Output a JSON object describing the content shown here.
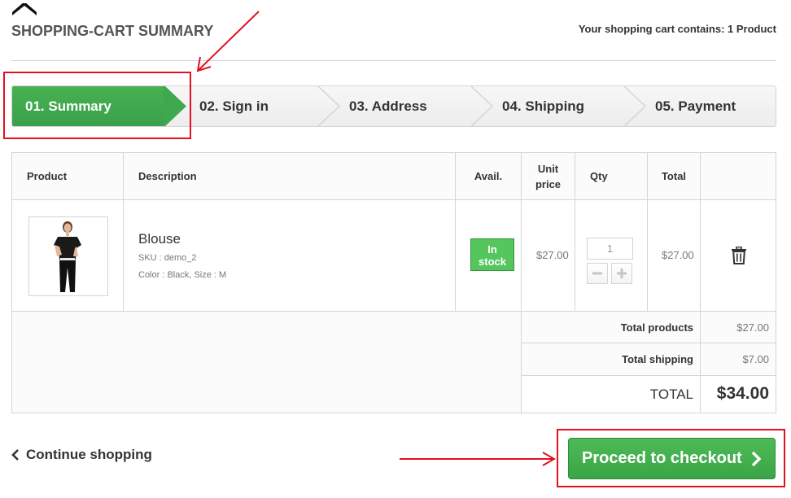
{
  "header": {
    "title": "SHOPPING-CART SUMMARY",
    "cart_count": "Your shopping cart contains: 1 Product"
  },
  "steps": [
    {
      "label": "01. Summary",
      "active": true
    },
    {
      "label": "02. Sign in",
      "active": false
    },
    {
      "label": "03. Address",
      "active": false
    },
    {
      "label": "04. Shipping",
      "active": false
    },
    {
      "label": "05. Payment",
      "active": false
    }
  ],
  "table": {
    "headers": {
      "product": "Product",
      "description": "Description",
      "avail": "Avail.",
      "unit_price_line1": "Unit",
      "unit_price_line2": "price",
      "qty": "Qty",
      "total": "Total"
    },
    "row": {
      "name": "Blouse",
      "sku": "SKU : demo_2",
      "attributes": "Color : Black, Size : M",
      "stock_line1": "In",
      "stock_line2": "stock",
      "unit_price": "$27.00",
      "qty": "1",
      "total": "$27.00"
    },
    "totals": {
      "products_label": "Total products",
      "products_value": "$27.00",
      "shipping_label": "Total shipping",
      "shipping_value": "$7.00",
      "grand_label": "TOTAL",
      "grand_value": "$34.00"
    }
  },
  "actions": {
    "continue": "Continue shopping",
    "checkout": "Proceed to checkout"
  },
  "colors": {
    "accent_green": "#3aa546",
    "annotation_red": "#e3111f"
  },
  "icons": [
    "chevron-up-icon",
    "trash-icon",
    "chevron-left-icon",
    "chevron-right-icon",
    "minus-icon",
    "plus-icon"
  ]
}
